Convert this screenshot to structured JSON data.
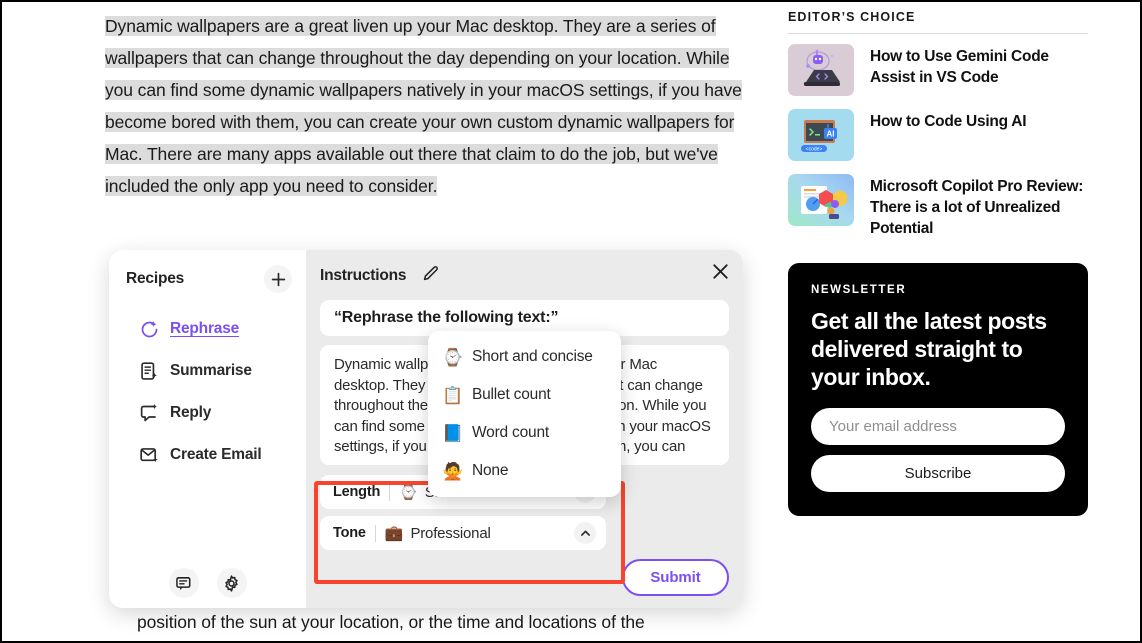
{
  "article": {
    "selected_paragraph": "Dynamic wallpapers are a great liven up your Mac desktop. They are a series of wallpapers that can change throughout the day depending on your location. While you can find some dynamic wallpapers natively in your macOS settings, if you have become bored with them, you can create your own custom dynamic wallpapers for Mac. There are many apps available out there that claim to do the job, but we've included the only app you need to consider.",
    "tail_line": "position of the sun at your location, or the time and locations of the"
  },
  "ai_panel": {
    "recipes": {
      "title": "Recipes",
      "add_icon": "plus-icon",
      "items": [
        {
          "label": "Rephrase",
          "icon": "rephrase-icon",
          "active": true
        },
        {
          "label": "Summarise",
          "icon": "summarise-icon",
          "active": false
        },
        {
          "label": "Reply",
          "icon": "reply-icon",
          "active": false
        },
        {
          "label": "Create Email",
          "icon": "create-email-icon",
          "active": false
        }
      ],
      "footer_icons": [
        "feedback-icon",
        "settings-gear-icon"
      ]
    },
    "instructions": {
      "title": "Instructions",
      "edit_icon": "pencil-icon",
      "close_icon": "close-icon",
      "prompt": "“Rephrase the following text:”",
      "source_text": "Dynamic wallpapers are a great liven up your Mac desktop. They are a series of wallpapers that can change throughout the day depending on your location. While you can find some dynamic wallpapers natively in your macOS settings, if you have become bored with them, you can",
      "options": [
        {
          "key": "Length",
          "emoji": "⌚",
          "value": "Short and concise",
          "chevron": "chevron-down-icon"
        },
        {
          "key": "Tone",
          "emoji": "💼",
          "value": "Professional",
          "chevron": "chevron-up-icon"
        }
      ],
      "submit_label": "Submit"
    },
    "length_menu": {
      "items": [
        {
          "emoji": "⌚",
          "label": "Short and concise"
        },
        {
          "emoji": "📋",
          "label": "Bullet count"
        },
        {
          "emoji": "📘",
          "label": "Word count"
        },
        {
          "emoji": "🙅",
          "label": "None"
        }
      ]
    },
    "annotation_color": "#f8442e",
    "accent_color": "#7b4ff0"
  },
  "sidebar": {
    "editors_choice_title": "EDITOR’S CHOICE",
    "articles": [
      {
        "title": "How to Use Gemini Code Assist in VS Code",
        "thumb": "gemini-code-assist-thumbnail"
      },
      {
        "title": "How to Code Using AI",
        "thumb": "code-using-ai-thumbnail"
      },
      {
        "title": "Microsoft Copilot Pro Review: There is a lot of Unrealized Potential",
        "thumb": "copilot-pro-review-thumbnail"
      }
    ],
    "newsletter": {
      "kicker": "NEWSLETTER",
      "headline": "Get all the latest posts delivered straight to your inbox.",
      "email_placeholder": "Your email address",
      "email_value": "",
      "subscribe_label": "Subscribe"
    }
  }
}
